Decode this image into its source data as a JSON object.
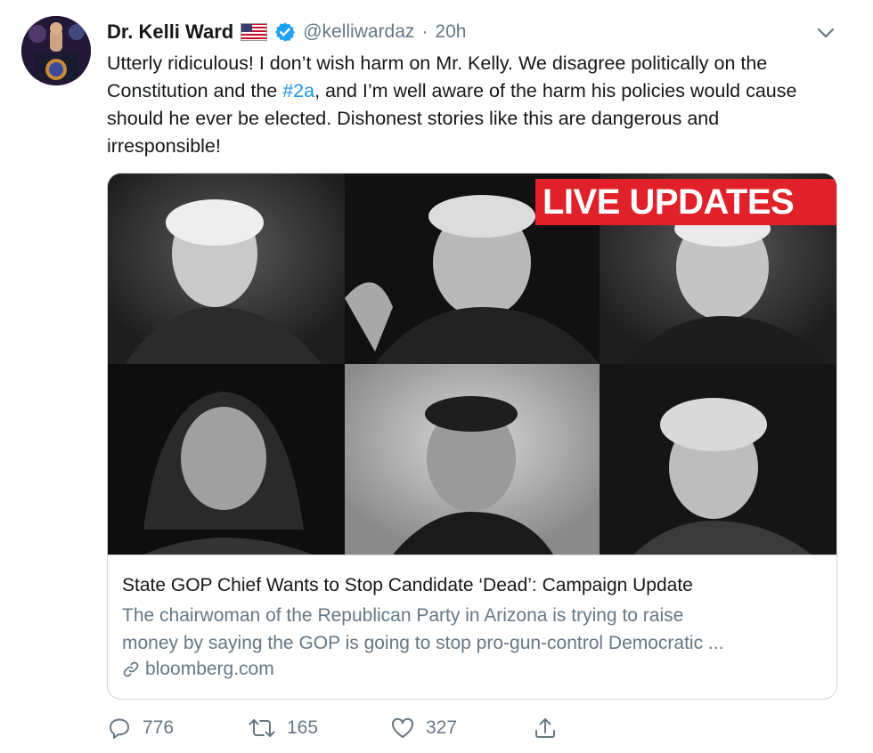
{
  "author": {
    "display_name": "Dr. Kelli Ward",
    "handle": "@kelliwardaz",
    "separator": "·",
    "time": "20h",
    "flag_icon": "us-flag-icon",
    "verified_icon": "verified-badge-icon"
  },
  "tweet": {
    "text_before": "Utterly ridiculous! I don’t wish harm on Mr. Kelly. We disagree politically on the Constitution and the ",
    "hashtag": "#2a",
    "text_after": ", and I’m well aware of the harm his policies would cause should he ever be elected. Dishonest stories like this are dangerous and irresponsible!"
  },
  "card": {
    "image_banner": "LIVE UPDATES",
    "title": "State GOP Chief Wants to Stop Candidate ‘Dead’: Campaign Update",
    "description_line1": "The chairwoman of the Republican Party in Arizona is trying to raise",
    "description_line2": "money by saying the GOP is going to stop pro-gun-control Democratic ...",
    "domain": "bloomberg.com"
  },
  "actions": {
    "reply_count": "776",
    "retweet_count": "165",
    "like_count": "327"
  },
  "colors": {
    "link_blue": "#1b95e0",
    "secondary_text": "#657786",
    "banner_red": "#e0212a",
    "verified_blue": "#1da1f2"
  }
}
